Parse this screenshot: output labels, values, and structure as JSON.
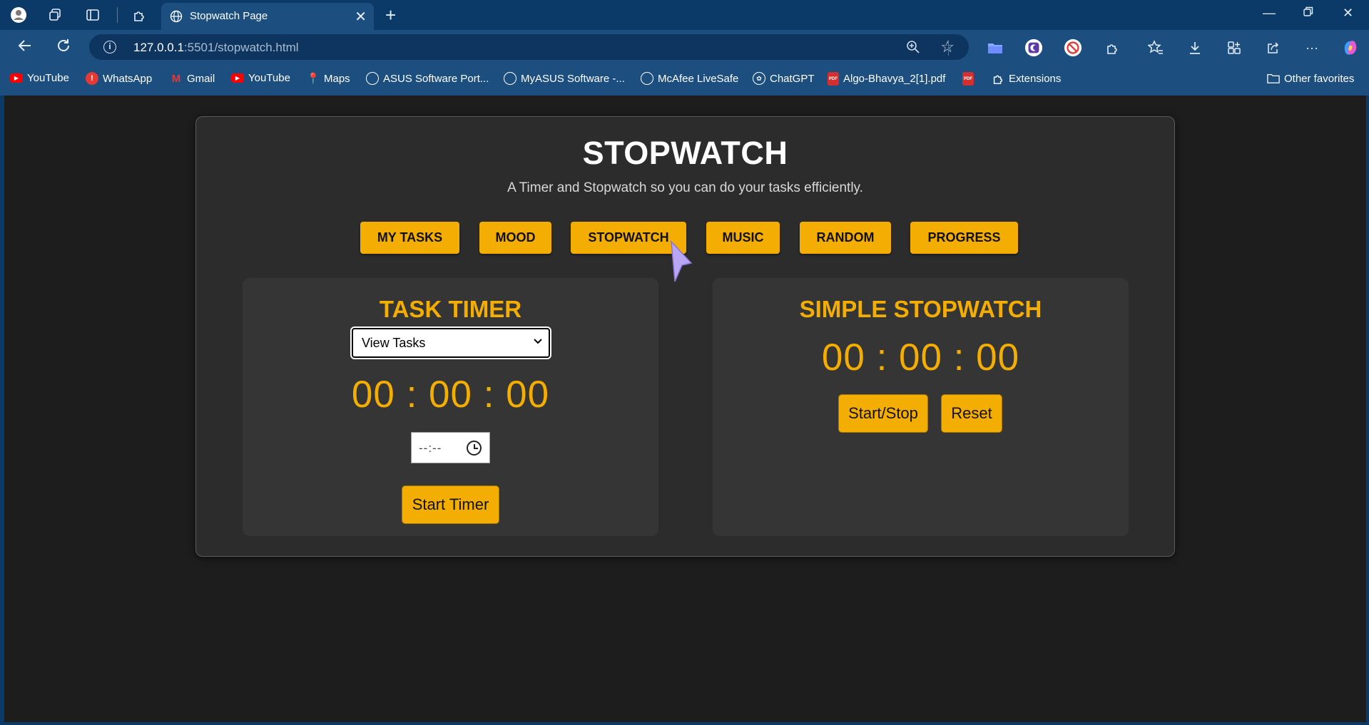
{
  "browser": {
    "tab_title": "Stopwatch Page",
    "url_host": "127.0.0.1",
    "url_path": ":5501/stopwatch.html",
    "bookmarks": [
      {
        "label": "YouTube"
      },
      {
        "label": "WhatsApp"
      },
      {
        "label": "Gmail"
      },
      {
        "label": "YouTube"
      },
      {
        "label": "Maps"
      },
      {
        "label": "ASUS Software Port..."
      },
      {
        "label": "MyASUS Software -..."
      },
      {
        "label": "McAfee LiveSafe"
      },
      {
        "label": "ChatGPT"
      },
      {
        "label": "Algo-Bhavya_2[1].pdf"
      },
      {
        "label": "Extensions"
      }
    ],
    "other_favorites": "Other favorites"
  },
  "page": {
    "title": "STOPWATCH",
    "subtitle": "A Timer and Stopwatch so you can do your tasks efficiently.",
    "nav": [
      "MY TASKS",
      "MOOD",
      "STOPWATCH",
      "MUSIC",
      "RANDOM",
      "PROGRESS"
    ],
    "task_timer": {
      "title": "TASK TIMER",
      "select_value": "View Tasks",
      "display": "00 : 00 : 00",
      "time_input": "--:--",
      "start_label": "Start Timer"
    },
    "simple_stopwatch": {
      "title": "SIMPLE STOPWATCH",
      "display": "00 : 00 : 00",
      "start_stop_label": "Start/Stop",
      "reset_label": "Reset"
    }
  },
  "colors": {
    "accent": "#f4ae03",
    "card_bg": "#2c2c2c",
    "panel_bg": "#353535",
    "page_bg": "#1d1d1d",
    "browser_chrome": "#1c4e80"
  }
}
